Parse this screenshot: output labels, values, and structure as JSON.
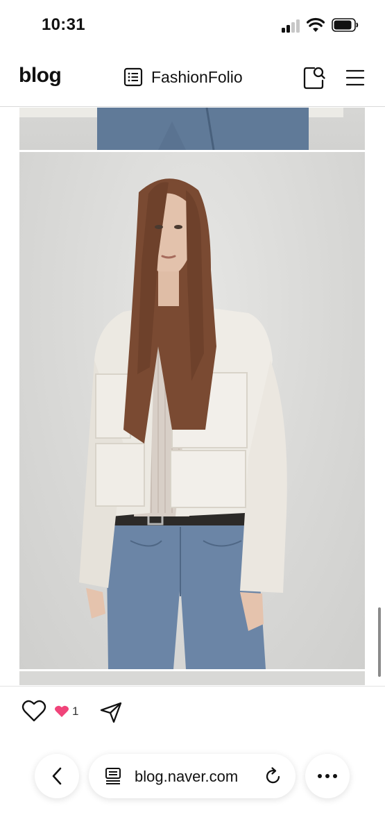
{
  "status_bar": {
    "time": "10:31",
    "icons": [
      "signal-icon",
      "wifi-icon",
      "battery-icon"
    ]
  },
  "header": {
    "brand": "blog",
    "blog_name": "FashionFolio",
    "icons": [
      "blog-list-icon",
      "search-post-icon",
      "menu-icon"
    ]
  },
  "content": {
    "photos": [
      "previous-photo-bottom",
      "main-photo-model-tweed-jacket",
      "next-photo-top"
    ]
  },
  "action_bar": {
    "like_count": "1",
    "icons": [
      "heart-outline-icon",
      "sympathy-heart-icon",
      "share-send-icon"
    ],
    "colors": {
      "sympathy": "#f0447a"
    }
  },
  "browser": {
    "url": "blog.naver.com",
    "icons": [
      "back-chevron-icon",
      "page-icon",
      "reload-icon",
      "more-dots-icon"
    ]
  }
}
